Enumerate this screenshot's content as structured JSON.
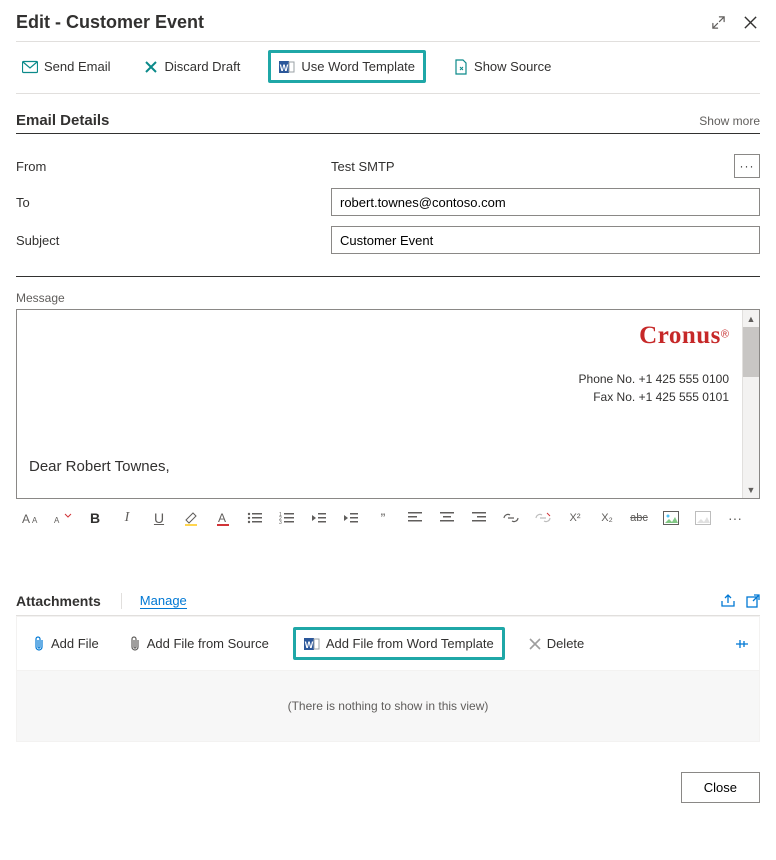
{
  "header": {
    "title": "Edit - Customer Event"
  },
  "toolbar": {
    "send_email": "Send Email",
    "discard_draft": "Discard Draft",
    "use_word_template": "Use Word Template",
    "show_source": "Show Source"
  },
  "section": {
    "email_details_title": "Email Details",
    "show_more": "Show more"
  },
  "fields": {
    "from_label": "From",
    "from_value": "Test SMTP",
    "to_label": "To",
    "to_value": "robert.townes@contoso.com",
    "subject_label": "Subject",
    "subject_value": "Customer Event"
  },
  "message": {
    "label": "Message",
    "brand": "Cronus",
    "brand_reg": "®",
    "phone_label": "Phone No.",
    "phone_value": "+1 425 555 0100",
    "fax_label": "Fax No.",
    "fax_value": "+1 425 555 0101",
    "greeting": "Dear Robert Townes,"
  },
  "attachments": {
    "title": "Attachments",
    "manage": "Manage",
    "add_file": "Add File",
    "add_from_source": "Add File from Source",
    "add_from_word": "Add File from Word Template",
    "delete": "Delete",
    "empty_text": "(There is nothing to show in this view)"
  },
  "footer": {
    "close": "Close"
  },
  "rte": {
    "bold": "B",
    "italic": "I",
    "underline": "U",
    "quote": "”",
    "sup": "X²",
    "sub": "X₂",
    "strike": "abc",
    "more": "···"
  },
  "colors": {
    "accent": "#0078d4",
    "highlight_border": "#1fa7a7",
    "brand_red": "#c62828"
  }
}
